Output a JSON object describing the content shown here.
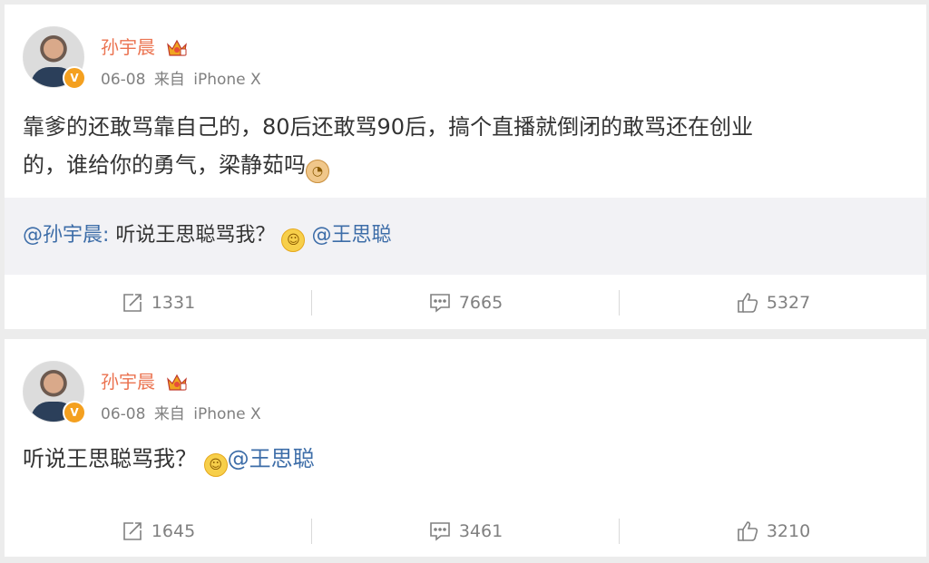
{
  "colors": {
    "name": "#eb7350",
    "mention": "#3d6da8",
    "meta": "#808080",
    "repost_bg": "#f2f2f5",
    "badge": "#f4a01f"
  },
  "posts": [
    {
      "author": "孙宇晨",
      "badge": "V",
      "date": "06-08",
      "source_prefix": "来自",
      "source": "iPhone X",
      "text_line1": "靠爹的还敢骂靠自己的，80后还敢骂90后，搞个直播就倒闭的敢骂还在创业",
      "text_line2": "的，谁给你的勇气，梁静茹吗",
      "emoji_doge": "doge-emoji",
      "repost": {
        "mention_author": "@孙宇晨",
        "colon": ":",
        "text": " 听说王思聪骂我？",
        "emoji": "smile-emoji",
        "mention_target": "@王思聪"
      },
      "actions": {
        "repost_count": "1331",
        "comment_count": "7665",
        "like_count": "5327"
      }
    },
    {
      "author": "孙宇晨",
      "badge": "V",
      "date": "06-08",
      "source_prefix": "来自",
      "source": "iPhone X",
      "text": "听说王思聪骂我？",
      "emoji": "smile-emoji",
      "mention": "@王思聪",
      "actions": {
        "repost_count": "1645",
        "comment_count": "3461",
        "like_count": "3210"
      }
    }
  ]
}
